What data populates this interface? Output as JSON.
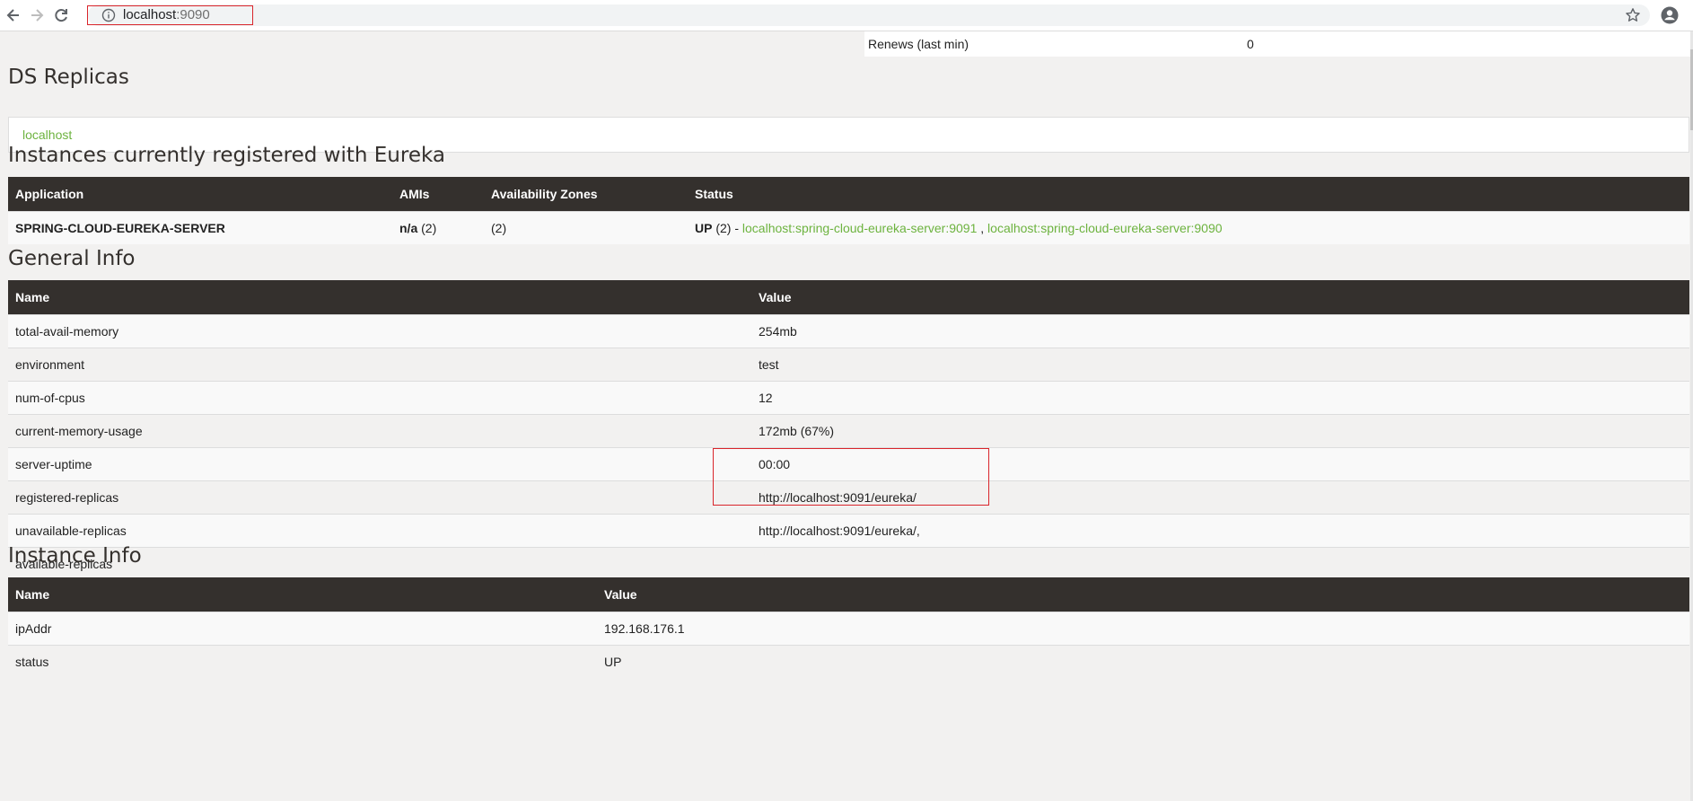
{
  "browser": {
    "url_host": "localhost",
    "url_port": ":9090"
  },
  "renews": {
    "name": "Renews (last min)",
    "value": "0"
  },
  "ds_replicas": {
    "title": "DS Replicas",
    "link": "localhost"
  },
  "instances": {
    "title": "Instances currently registered with Eureka",
    "headers": [
      "Application",
      "AMIs",
      "Availability Zones",
      "Status"
    ],
    "row": {
      "application": "SPRING-CLOUD-EUREKA-SERVER",
      "amis_bold": "n/a",
      "amis_count": " (2)",
      "zones": "(2)",
      "status_bold": "UP",
      "status_count": " (2) - ",
      "link1": "localhost:spring-cloud-eureka-server:9091",
      "separator": " , ",
      "link2": "localhost:spring-cloud-eureka-server:9090"
    }
  },
  "general_info": {
    "title": "General Info",
    "headers": [
      "Name",
      "Value"
    ],
    "rows": [
      {
        "name": "total-avail-memory",
        "value": "254mb"
      },
      {
        "name": "environment",
        "value": "test"
      },
      {
        "name": "num-of-cpus",
        "value": "12"
      },
      {
        "name": "current-memory-usage",
        "value": "172mb (67%)"
      },
      {
        "name": "server-uptime",
        "value": "00:00"
      },
      {
        "name": "registered-replicas",
        "value": "http://localhost:9091/eureka/"
      },
      {
        "name": "unavailable-replicas",
        "value": "http://localhost:9091/eureka/,"
      },
      {
        "name": "available-replicas",
        "value": ""
      }
    ]
  },
  "instance_info": {
    "title": "Instance Info",
    "headers": [
      "Name",
      "Value"
    ],
    "rows": [
      {
        "name": "ipAddr",
        "value": "192.168.176.1"
      },
      {
        "name": "status",
        "value": "UP"
      }
    ]
  },
  "colors": {
    "header_bg": "#34302d",
    "link_green": "#6db33f",
    "highlight_red": "#d9252b"
  }
}
